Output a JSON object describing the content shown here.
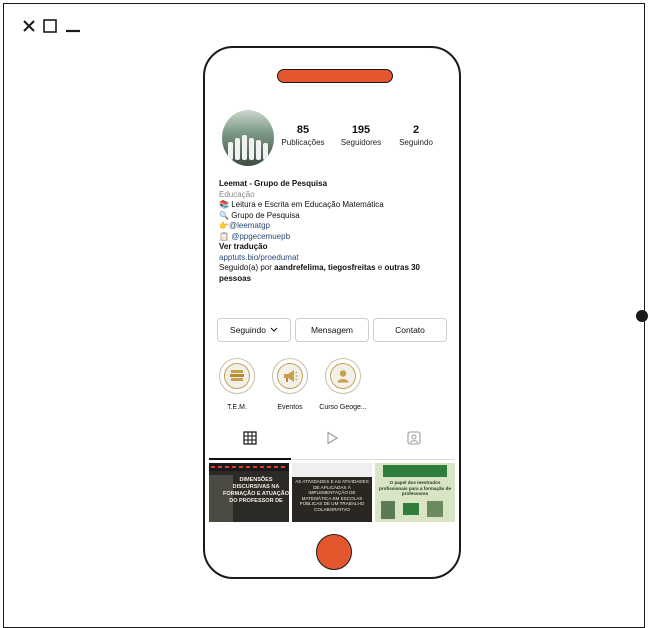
{
  "window": {
    "controls": [
      "close",
      "maximize",
      "minimize"
    ]
  },
  "colors": {
    "accent": "#e4572e",
    "link": "#2b4a7a"
  },
  "profile": {
    "stats": [
      {
        "value": "85",
        "label": "Publicações"
      },
      {
        "value": "195",
        "label": "Seguidores"
      },
      {
        "value": "2",
        "label": "Seguindo"
      }
    ],
    "name": "Leemat - Grupo de Pesquisa",
    "category": "Educação",
    "bio_lines": [
      "Leitura e Escrita em Educação Matemática",
      "Grupo de Pesquisa",
      "@leematgp",
      "@ppgecemuepb"
    ],
    "translate": "Ver tradução",
    "link": "apptuts.bio/proedumat",
    "followed_prefix": "Seguido(a) por ",
    "followed_names": "aandrefelima, tiegosfreitas",
    "followed_mid": " e ",
    "followed_others": "outras 30",
    "followed_others_2": "pessoas"
  },
  "buttons": {
    "following": "Seguindo",
    "message": "Mensagem",
    "contact": "Contato"
  },
  "highlights": [
    {
      "label": "T.E.M.",
      "icon": "books-icon"
    },
    {
      "label": "Eventos",
      "icon": "megaphone-icon"
    },
    {
      "label": "Curso Geoge...",
      "icon": "person-icon"
    }
  ],
  "posts": [
    {
      "text": "DIMENSÕES DISCURSIVAS NA FORMAÇÃO E ATUAÇÃO DO PROFESSOR DE"
    },
    {
      "text": "AS ATIVIDADES E AS ATIVIDADES DE APLICADAS À IMPLEMENTAÇÃO DE MATEMÁTICA EM ESCOLAS PÚBLICAS DE UM TRABALHO COLABORATIVO"
    },
    {
      "text": "O papel dos mestrados profissionais para a formação de professores"
    }
  ]
}
